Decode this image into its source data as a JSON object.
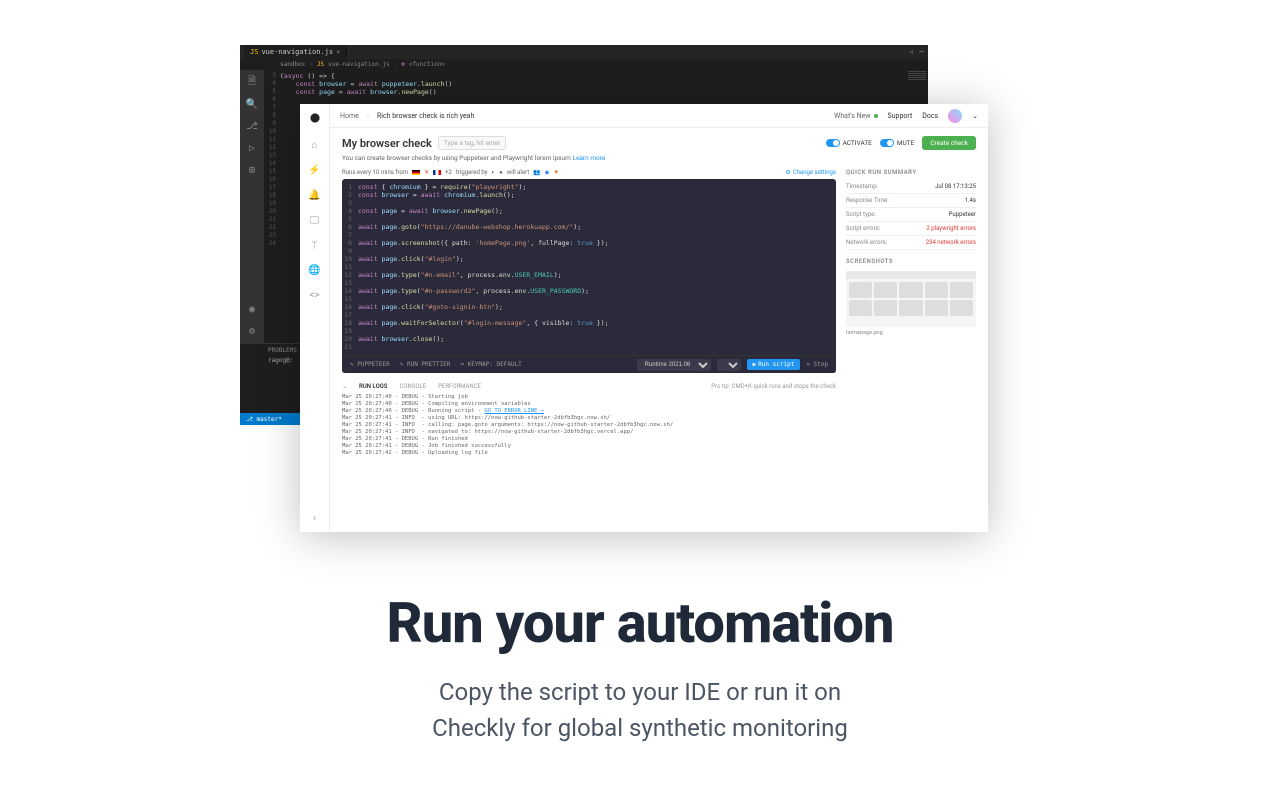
{
  "vscode": {
    "tab_file": "vue-navigation.js",
    "tab_close": "×",
    "breadcrumb": {
      "a": "sandbox",
      "b": "vue-navigation.js",
      "c": "<function>"
    },
    "gutter": [
      "3",
      "4",
      "5",
      "6",
      "7",
      "8",
      "9",
      "10",
      "11",
      "",
      "12",
      "13",
      "14",
      "15",
      "16",
      "17",
      "18",
      "19",
      "20",
      "21",
      "22",
      "23",
      "24"
    ],
    "panel_tab": "PROBLEMS",
    "panel_line": "ragog@:",
    "status_branch": "master*"
  },
  "checkly": {
    "nav": {
      "home": "Home",
      "crumb": "Rich browser check is rich yeah",
      "whats_new": "What's New",
      "support": "Support",
      "docs": "Docs"
    },
    "title": "My browser check",
    "tag_placeholder": "Type a tag, hit enter",
    "toggle_activate": "ACTIVATE",
    "toggle_mute": "MUTE",
    "create_btn": "Create check",
    "subtitle": "You can create browser checks by using Puppeteer and Playwright lorem ipsum",
    "learn_more": "Learn more",
    "runbar": {
      "prefix": "Runs every 10 mins from",
      "plus": "+2",
      "triggered": "triggered by",
      "alert": "will alert",
      "change": "Change settings"
    },
    "toolbar": {
      "puppeteer": "PUPPETEER",
      "prettier": "RUN PRETTIER",
      "keymap": "KEYMAP: DEFAULT",
      "runtime": "Runtime 2021.06",
      "run": "Run script",
      "stop": "Stop"
    },
    "logs": {
      "tab_run": "RUN LOGS",
      "tab_console": "CONSOLE",
      "tab_perf": "PERFORMANCE",
      "tip": "Pro tip: CMD+K quick runs and stops the check",
      "lines": [
        "Mar 25 20:27:40 - DEBUG - Starting job",
        "Mar 25 20:27:40 - DEBUG - Compiling environment variables",
        "Mar 25 20:27:40 - DEBUG - Running script - ",
        "Mar 25 20:27:41 - INFO  - using URL: https://now-github-starter-2dbfb3hgc.now.sh/",
        "Mar 25 20:27:41 - INFO  - calling: page.goto arguments: https://now-github-starter-2dbfb3hgc.now.sh/",
        "Mar 25 20:27:41 - INFO  - navigated_to: https://now-github-starter-2dbfb3hgc.vercel.app/",
        "Mar 25 20:27:41 - DEBUG - Run finished",
        "Mar 25 20:27:41 - DEBUG - Job finished successfully",
        "Mar 25 20:27:42 - DEBUG - Uploading log file"
      ],
      "error_link": "GO TO ERROR LINE →"
    },
    "summary": {
      "title": "QUICK RUN SUMMARY",
      "rows": [
        {
          "k": "Timestamp:",
          "v": "Jul 08 17:13:25"
        },
        {
          "k": "Response Time:",
          "v": "1.4s"
        },
        {
          "k": "Script type:",
          "v": "Puppeteer"
        },
        {
          "k": "Script errors:",
          "v": "2 playwright errors",
          "err": true
        },
        {
          "k": "Network errors:",
          "v": "234 network errors",
          "err": true
        }
      ],
      "screenshots_label": "SCREENSHOTS",
      "caption": "homepage.png"
    }
  },
  "hero": {
    "title": "Run your automation",
    "sub1": "Copy the script to your IDE or run it on",
    "sub2": "Checkly for global synthetic monitoring"
  }
}
